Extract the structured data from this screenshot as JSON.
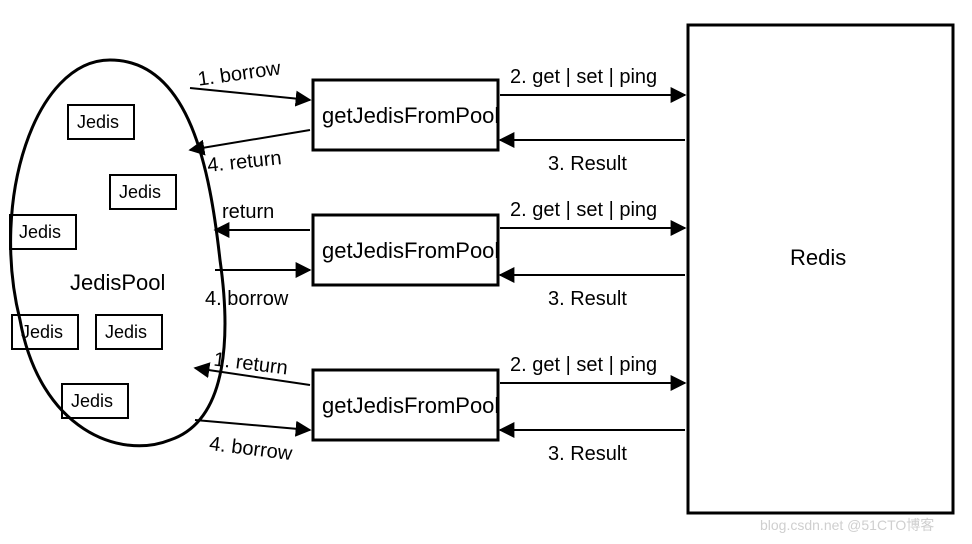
{
  "pool": {
    "label": "JedisPool",
    "items": [
      "Jedis",
      "Jedis",
      "Jedis",
      "Jedis",
      "Jedis",
      "Jedis"
    ]
  },
  "workers": [
    {
      "label": "getJedisFromPool",
      "left_top": "1. borrow",
      "left_bottom": "4. return",
      "right_top": "2. get | set | ping",
      "right_bottom": "3. Result"
    },
    {
      "label": "getJedisFromPool",
      "left_top": "return",
      "left_bottom": "4. borrow",
      "right_top": "2. get | set | ping",
      "right_bottom": "3. Result"
    },
    {
      "label": "getJedisFromPool",
      "left_top": "1. return",
      "left_bottom": "4. borrow",
      "right_top": "2. get | set | ping",
      "right_bottom": "3. Result"
    }
  ],
  "server": {
    "label": "Redis"
  },
  "watermark": "blog.csdn.net @51CTO博客"
}
